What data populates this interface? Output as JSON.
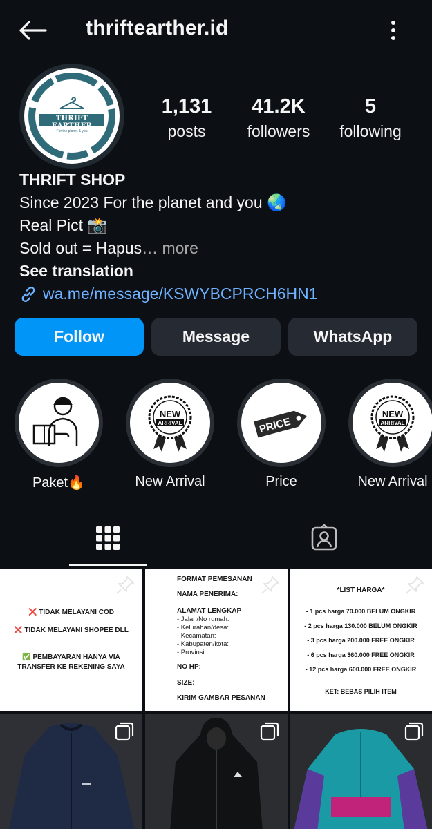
{
  "header": {
    "username": "thriftearther.id",
    "back_icon": "arrow-left-icon",
    "menu_icon": "vertical-dots-icon"
  },
  "profile": {
    "avatar_logo_text": "THRIFT EARTHER",
    "avatar_logo_subtitle": "For the planet & you",
    "stats": [
      {
        "value": "1,131",
        "label": "posts"
      },
      {
        "value": "41.2K",
        "label": "followers"
      },
      {
        "value": "5",
        "label": "following"
      }
    ]
  },
  "bio": {
    "name": "THRIFT SHOP",
    "line1": "Since 2023 For the planet and you 🌏",
    "line2": "Real Pict 📸",
    "line3": "Sold out = Hapus",
    "more": "… more",
    "see_translation": "See translation",
    "link": "wa.me/message/KSWYBCPRCH6HN1"
  },
  "actions": {
    "follow": "Follow",
    "message": "Message",
    "whatsapp": "WhatsApp"
  },
  "highlights": [
    {
      "label": "Paket🔥",
      "icon": "delivery-person-icon"
    },
    {
      "label": "New Arrival",
      "icon": "new-arrival-badge-icon",
      "badge_top": "NEW",
      "badge_bottom": "ARRIVAL"
    },
    {
      "label": "Price",
      "icon": "price-tag-icon",
      "tag_text": "PRICE"
    },
    {
      "label": "New Arrival",
      "icon": "new-arrival-badge-icon",
      "badge_top": "NEW",
      "badge_bottom": "ARRIVAL"
    }
  ],
  "tabs": [
    {
      "name": "posts-grid",
      "icon": "grid-icon",
      "active": true
    },
    {
      "name": "tagged",
      "icon": "tagged-user-icon",
      "active": false
    }
  ],
  "posts": {
    "post1": {
      "lines": [
        "❌ TIDAK MELAYANI COD",
        "❌ TIDAK MELAYANI SHOPEE DLL",
        "✅ PEMBAYARAN HANYA VIA",
        "TRANSFER KE REKENING SAYA"
      ]
    },
    "post2": {
      "lines": [
        "FORMAT PEMESANAN",
        "NAMA PENERIMA:",
        "ALAMAT LENGKAP",
        " - Jalan/No rumah:",
        " - Kelurahan/desa:",
        " - Kecamatan:",
        " - Kabupaten/kota:",
        " - Provinsi:",
        "NO HP:",
        "SIZE:",
        "KIRIM GAMBAR PESANAN"
      ]
    },
    "post3": {
      "lines": [
        "*LIST HARGA*",
        "- 1 pcs harga 70.000 BELUM ONGKIR",
        "- 2 pcs harga 130.000 BELUM ONGKIR",
        "- 3 pcs harga 200.000 FREE ONGKIR",
        "- 6 pcs harga 360.000 FREE ONGKIR",
        "- 12 pcs harga 600.000 FREE ONGKIR",
        "KET: BEBAS PILIH ITEM"
      ]
    },
    "jacket_colors": {
      "navy": "#1f2a44",
      "black": "#111214",
      "teal": "#1a9aa5",
      "magenta": "#c2237a"
    }
  },
  "colors": {
    "background": "#0c0f14",
    "accent": "#0095f6",
    "link": "#6fb2ff",
    "button_secondary": "#262b33"
  }
}
